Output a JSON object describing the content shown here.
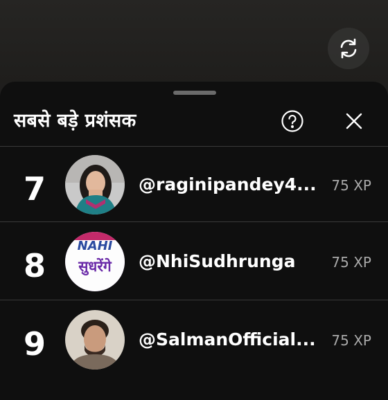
{
  "header": {
    "title": "सबसे बड़े प्रशंसक",
    "help_icon": "help-circle-icon",
    "close_icon": "close-icon",
    "refresh_icon": "refresh-icon"
  },
  "fans": [
    {
      "rank": "7",
      "username": "@raginipandey4...",
      "xp": "75 XP"
    },
    {
      "rank": "8",
      "username": "@NhiSudhrunga",
      "xp": "75 XP",
      "avatar_text_top": "NAHI",
      "avatar_text_bottom": "सुधरेंगे"
    },
    {
      "rank": "9",
      "username": "@SalmanOfficial...",
      "xp": "75 XP"
    }
  ],
  "colors": {
    "sheet_bg": "#0f0f0f",
    "avatar_8_bg": "#5b2a9a"
  }
}
